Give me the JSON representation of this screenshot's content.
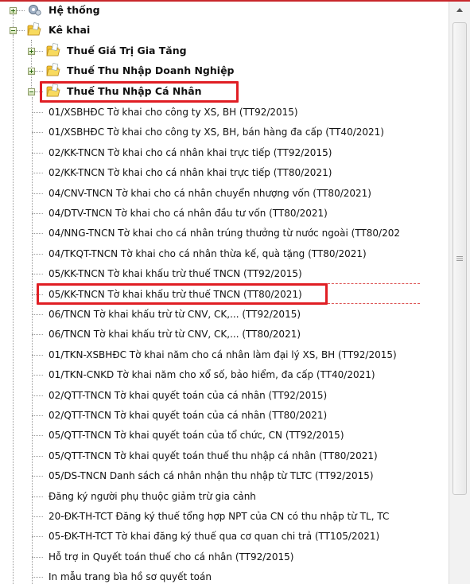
{
  "tree": {
    "nodes": [
      {
        "name": "tree-node-he-thong",
        "label": "Hệ thống",
        "level": 0,
        "kind": "root",
        "icon": "system-gear-icon",
        "expander": "plus"
      },
      {
        "name": "tree-node-ke-khai",
        "label": "Kê khai",
        "level": 0,
        "kind": "root",
        "icon": "folder-icon",
        "expander": "minus"
      },
      {
        "name": "tree-node-thue-gtgt",
        "label": "Thuế Giá Trị Gia Tăng",
        "level": 1,
        "kind": "folder",
        "icon": "folder-icon",
        "expander": "plus"
      },
      {
        "name": "tree-node-thue-tndn",
        "label": "Thuế Thu Nhập Doanh Nghiệp",
        "level": 1,
        "kind": "folder",
        "icon": "folder-icon",
        "expander": "plus"
      },
      {
        "name": "tree-node-thue-tncn",
        "label": "Thuế Thu Nhập Cá Nhân",
        "level": 1,
        "kind": "folder",
        "icon": "folder-icon",
        "expander": "minus",
        "highlighted": true
      },
      {
        "name": "tree-item",
        "label": "01/XSBHĐC Tờ khai cho công ty XS, BH (TT92/2015)",
        "level": 2,
        "kind": "item"
      },
      {
        "name": "tree-item",
        "label": "01/XSBHĐC Tờ khai cho công ty XS, BH, bán hàng đa cấp (TT40/2021)",
        "level": 2,
        "kind": "item"
      },
      {
        "name": "tree-item",
        "label": "02/KK-TNCN Tờ khai cho cá nhân khai trực tiếp (TT92/2015)",
        "level": 2,
        "kind": "item"
      },
      {
        "name": "tree-item",
        "label": "02/KK-TNCN Tờ khai cho cá nhân khai trực tiếp (TT80/2021)",
        "level": 2,
        "kind": "item"
      },
      {
        "name": "tree-item",
        "label": "04/CNV-TNCN Tờ khai cho cá nhân chuyển nhượng vốn (TT80/2021)",
        "level": 2,
        "kind": "item"
      },
      {
        "name": "tree-item",
        "label": "04/DTV-TNCN Tờ khai cho cá nhân đầu tư vốn (TT80/2021)",
        "level": 2,
        "kind": "item"
      },
      {
        "name": "tree-item",
        "label": "04/NNG-TNCN Tờ khai cho cá nhân trúng thưởng từ nước ngoài (TT80/202",
        "level": 2,
        "kind": "item"
      },
      {
        "name": "tree-item",
        "label": "04/TKQT-TNCN Tờ khai cho cá nhân thừa kế, quà tặng (TT80/2021)",
        "level": 2,
        "kind": "item"
      },
      {
        "name": "tree-item",
        "label": "05/KK-TNCN Tờ khai khấu trừ thuế TNCN (TT92/2015)",
        "level": 2,
        "kind": "item"
      },
      {
        "name": "tree-item-selected",
        "label": "05/KK-TNCN Tờ khai khấu trừ thuế TNCN (TT80/2021)",
        "level": 2,
        "kind": "item",
        "highlighted": true
      },
      {
        "name": "tree-item",
        "label": "06/TNCN Tờ khai khấu trừ từ CNV, CK,... (TT92/2015)",
        "level": 2,
        "kind": "item"
      },
      {
        "name": "tree-item",
        "label": "06/TNCN Tờ khai khấu trừ từ CNV, CK,... (TT80/2021)",
        "level": 2,
        "kind": "item"
      },
      {
        "name": "tree-item",
        "label": "01/TKN-XSBHĐC Tờ khai năm cho cá nhân làm đại lý XS, BH (TT92/2015)",
        "level": 2,
        "kind": "item"
      },
      {
        "name": "tree-item",
        "label": "01/TKN-CNKD Tờ khai năm cho xổ số, bảo hiểm, đa cấp (TT40/2021)",
        "level": 2,
        "kind": "item"
      },
      {
        "name": "tree-item",
        "label": "02/QTT-TNCN Tờ khai quyết toán của cá nhân (TT92/2015)",
        "level": 2,
        "kind": "item"
      },
      {
        "name": "tree-item",
        "label": "02/QTT-TNCN Tờ khai quyết toán của cá nhân (TT80/2021)",
        "level": 2,
        "kind": "item"
      },
      {
        "name": "tree-item",
        "label": "05/QTT-TNCN Tờ khai quyết toán của tổ chức, CN (TT92/2015)",
        "level": 2,
        "kind": "item"
      },
      {
        "name": "tree-item",
        "label": "05/QTT-TNCN Tờ khai quyết toán thuế thu nhập cá nhân (TT80/2021)",
        "level": 2,
        "kind": "item"
      },
      {
        "name": "tree-item",
        "label": "05/DS-TNCN Danh sách cá nhân nhận thu nhập từ TLTC (TT92/2015)",
        "level": 2,
        "kind": "item"
      },
      {
        "name": "tree-item",
        "label": "Đăng ký người phụ thuộc giảm trừ gia cảnh",
        "level": 2,
        "kind": "item"
      },
      {
        "name": "tree-item",
        "label": "20-ĐK-TH-TCT Đăng ký thuế tổng hợp NPT của CN có thu nhập từ TL, TC",
        "level": 2,
        "kind": "item"
      },
      {
        "name": "tree-item",
        "label": "05-ĐK-TH-TCT Tờ khai đăng ký thuế qua cơ quan chi trả (TT105/2021)",
        "level": 2,
        "kind": "item"
      },
      {
        "name": "tree-item",
        "label": "Hỗ trợ in Quyết toán thuế cho cá nhân (TT92/2015)",
        "level": 2,
        "kind": "item"
      },
      {
        "name": "tree-item",
        "label": "In mẫu trang bìa hồ sơ quyết toán",
        "level": 2,
        "kind": "item"
      }
    ]
  },
  "scrollbar": {
    "up_arrow_icon": "scroll-up-arrow-icon",
    "grip_icon": "scroll-grip-icon",
    "position_fraction": 0.0,
    "visible_fraction": 0.82
  },
  "colors": {
    "highlight_border": "#e01e24",
    "folder": "#f2c230",
    "tree_line": "#9a9a9a",
    "top_border": "#c8262a"
  }
}
